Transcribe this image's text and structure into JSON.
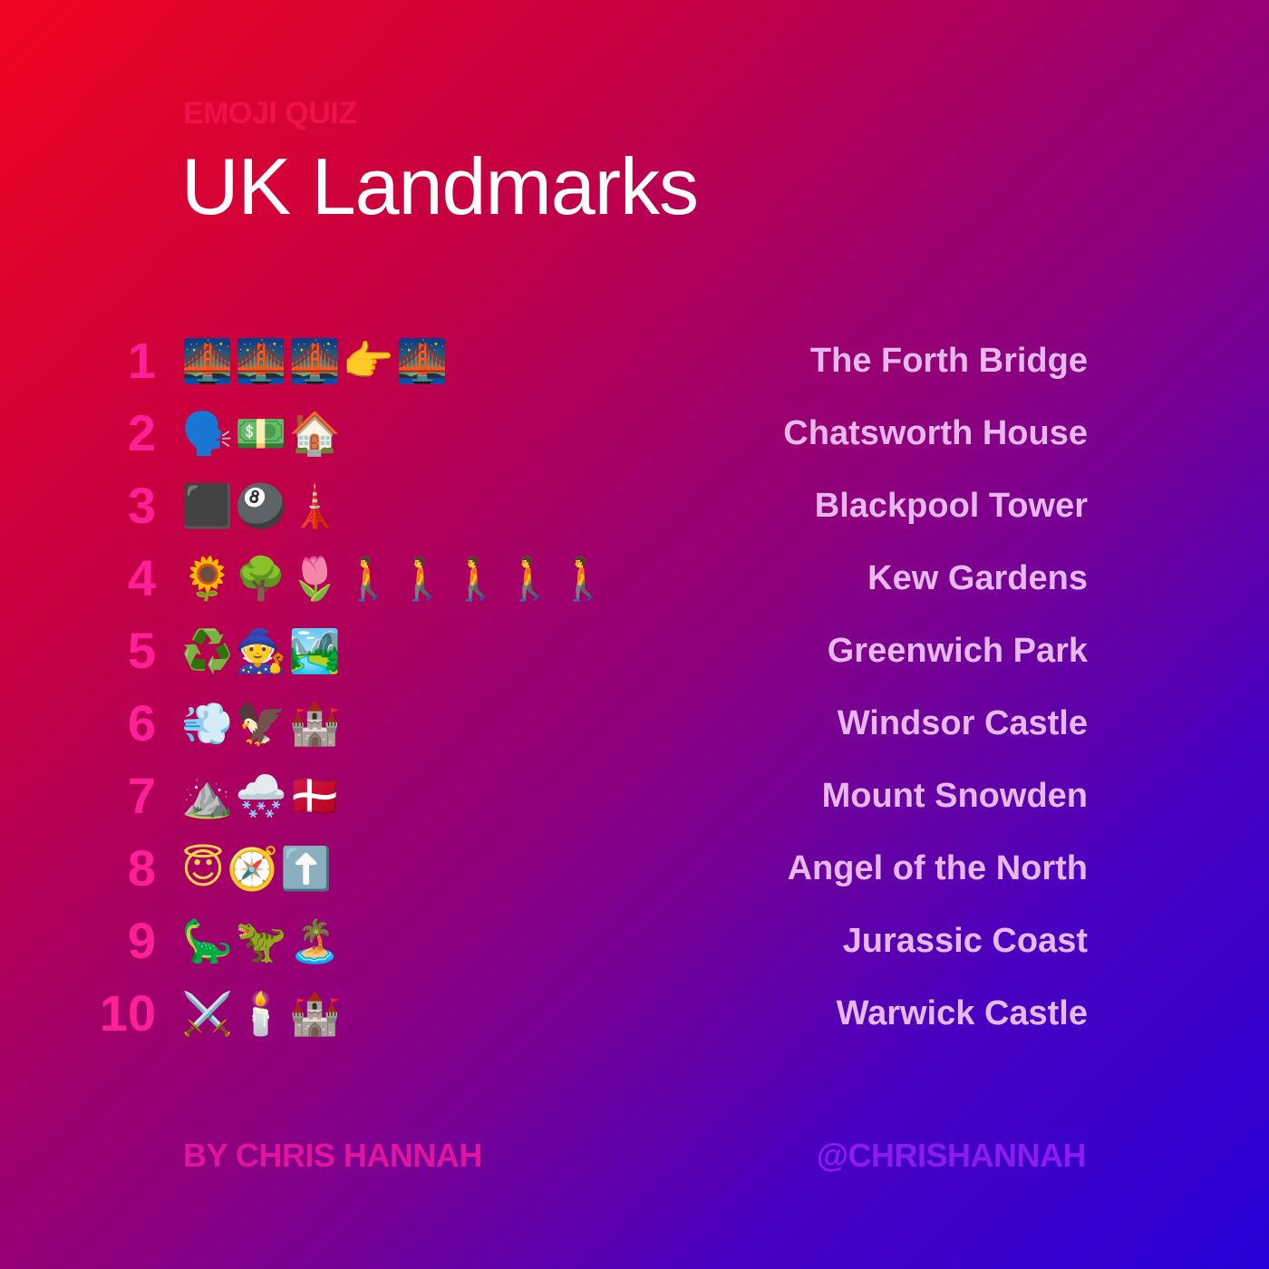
{
  "header": {
    "eyebrow": "EMOJI QUIZ",
    "title": "UK Landmarks"
  },
  "items": [
    {
      "number": "1",
      "clue": "🌉🌉🌉👉🌉",
      "answer": "The Forth Bridge"
    },
    {
      "number": "2",
      "clue": "🗣️💵🏠",
      "answer": "Chatsworth House"
    },
    {
      "number": "3",
      "clue": "⬛🎱🗼",
      "answer": "Blackpool Tower"
    },
    {
      "number": "4",
      "clue": "🌻🌳🌷🚶🚶🚶🚶🚶",
      "answer": "Kew Gardens"
    },
    {
      "number": "5",
      "clue": "♻️🧙🏞️",
      "answer": "Greenwich Park"
    },
    {
      "number": "6",
      "clue": "💨🦅🏰",
      "answer": "Windsor Castle"
    },
    {
      "number": "7",
      "clue": "⛰️🌨️🇩🇰",
      "answer": "Mount Snowden"
    },
    {
      "number": "8",
      "clue": "😇🧭⬆️",
      "answer": "Angel of the North"
    },
    {
      "number": "9",
      "clue": "🦕🦖🏝️",
      "answer": "Jurassic Coast"
    },
    {
      "number": "10",
      "clue": "⚔️🕯️🏰",
      "answer": "Warwick Castle"
    }
  ],
  "footer": {
    "author": "BY CHRIS HANNAH",
    "handle": "@CHRISHANNAH"
  }
}
